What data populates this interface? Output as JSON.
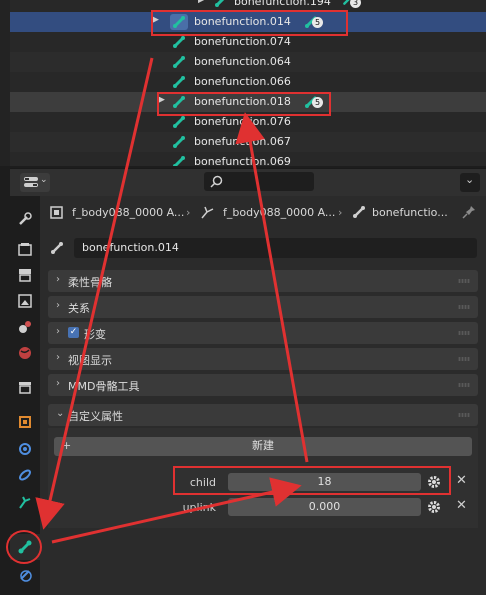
{
  "outliner": {
    "rows": [
      {
        "label": "bonefunction.194",
        "badge": "3"
      },
      {
        "label": "bonefunction.014",
        "badge": "5"
      },
      {
        "label": "bonefunction.074"
      },
      {
        "label": "bonefunction.064"
      },
      {
        "label": "bonefunction.066"
      },
      {
        "label": "bonefunction.018",
        "badge": "5"
      },
      {
        "label": "bonefunction.076"
      },
      {
        "label": "bonefunction.067"
      },
      {
        "label": "bonefunction.069"
      }
    ]
  },
  "breadcrumb": {
    "item1": "f_body088_0000 A...",
    "item2": "f_body088_0000 A...",
    "item3": "bonefunctio..."
  },
  "bone_name": "bonefunction.014",
  "panels": {
    "bendy_bones": "柔性骨骼",
    "relations": "关系",
    "transform": "形变",
    "viewport_display": "视图显示",
    "mmd_bone_tools": "MMD骨骼工具",
    "custom_properties": "自定义属性"
  },
  "custom_props": {
    "new_button": "新建",
    "properties": [
      {
        "label": "child",
        "value": "18"
      },
      {
        "label": "uplink",
        "value": "0.000"
      }
    ]
  },
  "colors": {
    "bone_icon": "#21c0a0",
    "active_row": "#334d80",
    "annotation": "#e03131",
    "checkbox": "#4772b3"
  }
}
